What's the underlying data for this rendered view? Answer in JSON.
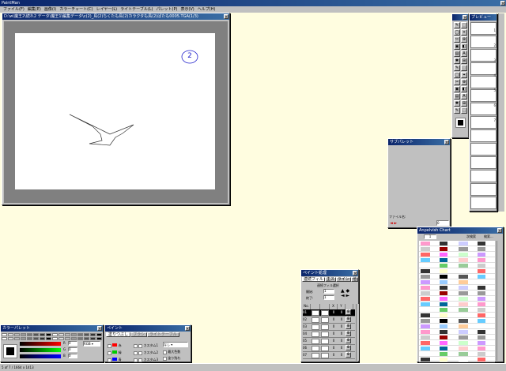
{
  "app": {
    "title": "PaintMan",
    "menu": [
      "ファイル(F)",
      "編集(E)",
      "画像(I)",
      "カラーチャート(C)",
      "レイヤー(L)",
      "ライトテーブル(L)",
      "パレット(P)",
      "表示(V)",
      "ヘルプ(H)"
    ]
  },
  "doc": {
    "title": "D:\\w\\魔王2\\続れ2 データ\\魔王1\\編集データ\\c(2)_鳥(2)ちくたも鳥(2)カラクタも鳥(2)ぱたも0005.TGA(1/3)",
    "annotation": "2"
  },
  "subpal": {
    "title": "サブパレット",
    "file_label": "ファイル名:",
    "value": "0"
  },
  "paint_proc": {
    "title": "ペイント処理",
    "tabs": [
      "連続フィル",
      "主ス",
      "ライン",
      "他"
    ],
    "section_label": "連続フィル選択",
    "start_label": "開始:",
    "start": "1",
    "end_label": "終了:",
    "end": "1",
    "headers": [
      "No.",
      "",
      "",
      "X",
      "Y",
      ""
    ],
    "rows": [
      [
        "01",
        "0",
        "0"
      ],
      [
        "02",
        "0",
        "0"
      ],
      [
        "03",
        "0",
        "0"
      ],
      [
        "04",
        "0",
        "0"
      ],
      [
        "05",
        "0",
        "0"
      ],
      [
        "06",
        "0",
        "0"
      ],
      [
        "07",
        "0",
        "0"
      ]
    ]
  },
  "color_pal": {
    "title": "カラーパレット",
    "r_label": "R",
    "g_label": "G",
    "b_label": "B",
    "r": "0",
    "g": "0",
    "b": "0",
    "mode": "RGB"
  },
  "paint": {
    "title": "ペイント",
    "tabs": [
      "塗りつぶし",
      "ブラシ",
      "ライトテーブル"
    ],
    "c1": "赤",
    "c2": "緑",
    "c3": "青",
    "custom1": "カスタム1",
    "custom2": "カスタム2",
    "custom3": "カスタム3",
    "sel": "なし",
    "cb1": "最大色数",
    "cb2": "塗り残れ"
  },
  "chart": {
    "title": "Anpelvish Chart",
    "sel": "1",
    "c1": "次検索",
    "c2": "検索..."
  },
  "preview": {
    "title": "プレビュー",
    "numbers": [
      "1",
      "2",
      "3",
      "4",
      "5",
      "6",
      "7"
    ]
  },
  "status": {
    "text": "5 of 7 / 1664 x 1413"
  },
  "colors": {
    "accent": "#0a246a",
    "bg": "#fffde0"
  }
}
